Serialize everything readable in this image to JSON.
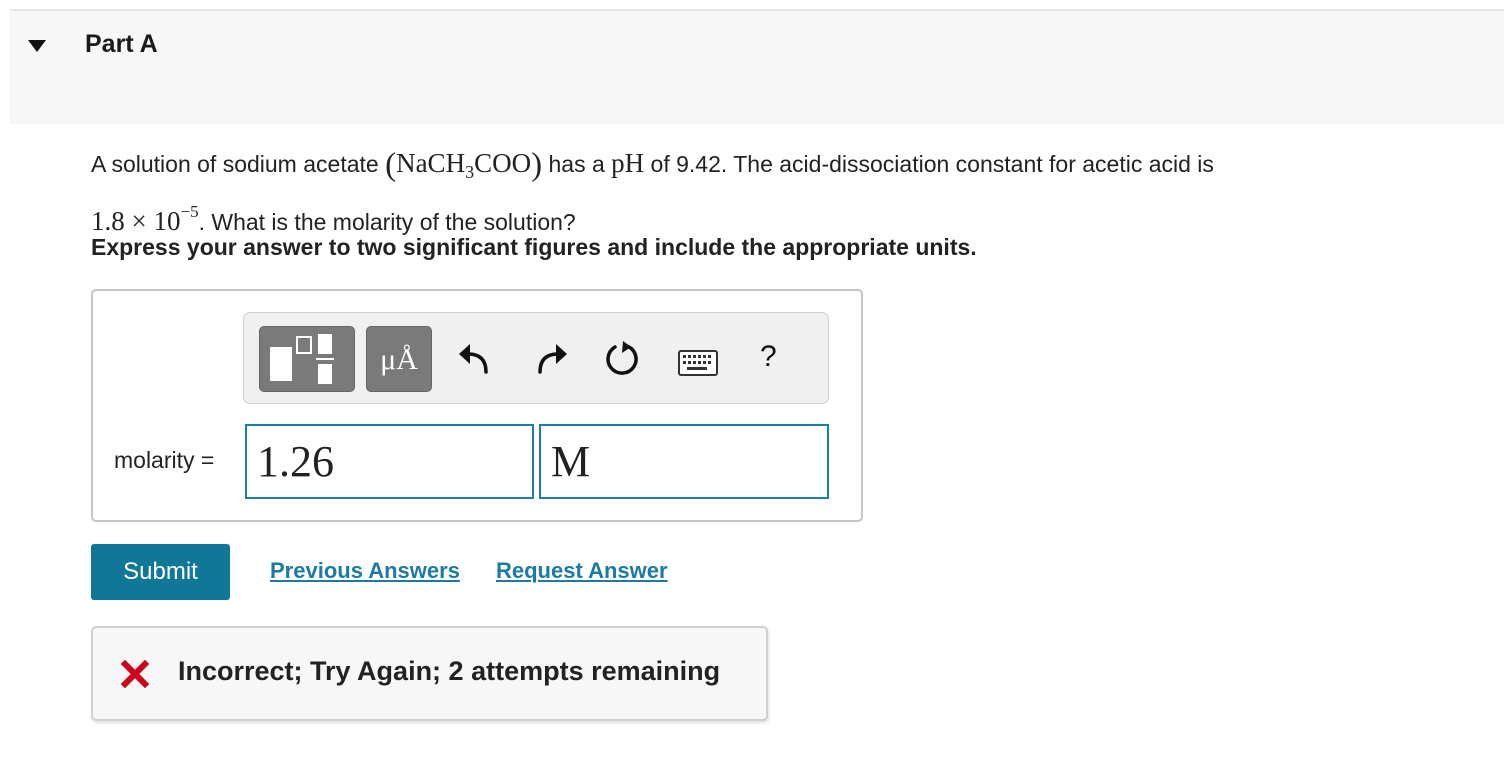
{
  "part": {
    "title": "Part A"
  },
  "question": {
    "text_1": "A solution of sodium acetate ",
    "formula_open": "(",
    "formula_main": "NaCH",
    "formula_sub": "3",
    "formula_tail": "COO",
    "formula_close": ")",
    "text_2": " has a ",
    "ph_symbol": "pH",
    "text_3": " of 9.42. The acid-dissociation constant for acetic acid is",
    "ka_mantissa": "1.8 × 10",
    "ka_exponent": "−5",
    "text_4": ". What is the molarity of the solution?",
    "instruction": "Express your answer to two significant figures and include the appropriate units."
  },
  "toolbar": {
    "units_button_label": "μÅ",
    "help_label": "?"
  },
  "answer": {
    "label": "molarity =",
    "value": "1.26",
    "units": "M"
  },
  "actions": {
    "submit_label": "Submit",
    "previous_answers_label": "Previous Answers",
    "request_answer_label": "Request Answer"
  },
  "feedback": {
    "message": "Incorrect; Try Again; 2 attempts remaining"
  },
  "colors": {
    "accent": "#117799",
    "link": "#1c7aa3",
    "error_icon": "#d0021b",
    "input_border": "#1a7fa6"
  }
}
